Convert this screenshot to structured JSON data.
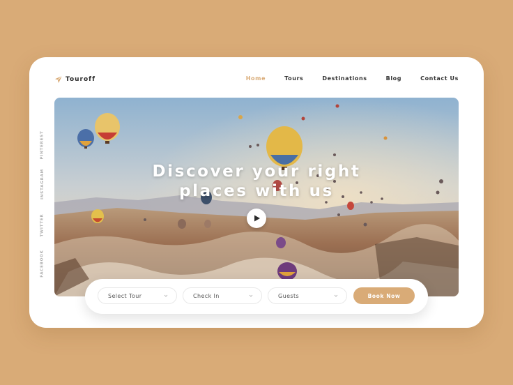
{
  "brand": {
    "name": "Touroff",
    "accent_color": "#d9ab77",
    "logo_icon": "paper-plane-icon"
  },
  "nav": {
    "items": [
      {
        "label": "Home",
        "active": true
      },
      {
        "label": "Tours",
        "active": false
      },
      {
        "label": "Destinations",
        "active": false
      },
      {
        "label": "Blog",
        "active": false
      },
      {
        "label": "Contact Us",
        "active": false
      }
    ]
  },
  "social": [
    "PINTEREST",
    "INSTAGRAM",
    "TWITTER",
    "FACEBOOK"
  ],
  "hero": {
    "headline_line1": "Discover your right",
    "headline_line2": "places with us",
    "play_icon": "play-icon"
  },
  "booking": {
    "fields": [
      {
        "label": "Select Tour",
        "icon": "chevron-down-icon"
      },
      {
        "label": "Check In",
        "icon": "chevron-down-icon"
      },
      {
        "label": "Guests",
        "icon": "chevron-down-icon"
      }
    ],
    "button_label": "Book Now"
  },
  "colors": {
    "page_background": "#d9ab77",
    "card": "#ffffff",
    "text_dark": "#333333"
  }
}
